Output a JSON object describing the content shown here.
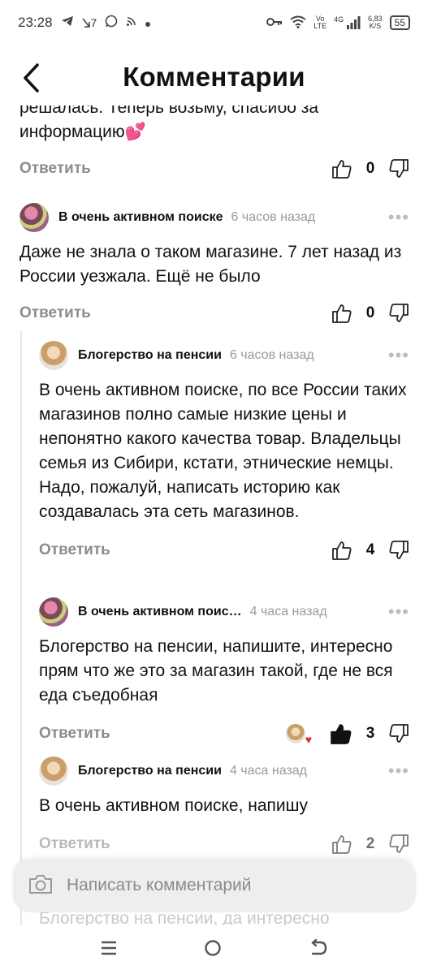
{
  "status_bar": {
    "time": "23:28",
    "left_icons": [
      "telegram-icon",
      "missed-call-icon",
      "whatsapp-icon",
      "podcast-icon",
      "dot-icon"
    ],
    "call_badge": "7",
    "net_lte_top": "Vo",
    "net_lte_bottom": "LTE",
    "net_4g": "4G",
    "speed_value": "6,83",
    "speed_unit": "K/S",
    "battery": "55"
  },
  "header": {
    "title": "Комментарии"
  },
  "partial_comment": {
    "text_line1": "решалась. Теперь возьму, спасибо за",
    "text_line2": "информацию",
    "emoji": "💕",
    "reply_label": "Ответить",
    "likes": "0"
  },
  "comments": [
    {
      "author": "В очень активном поиске",
      "time": "6 часов назад",
      "text": "Даже не знала о таком магазине. 7 лет назад из России уезжала. Ещё не было",
      "reply_label": "Ответить",
      "likes": "0"
    },
    {
      "author": "Блогерство на пенсии",
      "time": "6 часов назад",
      "text": "В очень активном поиске, по все России таких магазинов полно самые низкие цены и непонятно какого качества товар. Владельцы семья из Сибири, кстати, этнические немцы. Надо, пожалуй, написать историю как создавалась эта сеть магазинов.",
      "reply_label": "Ответить",
      "likes": "4"
    },
    {
      "author": "В очень активном поис…",
      "time": "4 часа назад",
      "text": "Блогерство на пенсии, напишите, интересно прям что же это за магазин такой, где не вся еда съедобная",
      "reply_label": "Ответить",
      "likes": "3"
    },
    {
      "author": "Блогерство на пенсии",
      "time": "4 часа назад",
      "text": "В очень активном поиске, напишу",
      "reply_label": "Ответить",
      "likes": "2"
    }
  ],
  "composer": {
    "placeholder": "Написать комментарий"
  },
  "ghost_text": "Блогерство на пенсии, да интересно",
  "more_glyph": "•••",
  "colors": {
    "liked_thumb": "#111111",
    "heart": "#e0303a",
    "muted": "#8c8c8c"
  }
}
